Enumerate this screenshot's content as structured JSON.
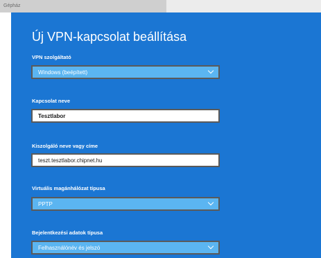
{
  "window": {
    "title": "Gépház"
  },
  "page": {
    "heading": "Új VPN-kapcsolat beállítása"
  },
  "form": {
    "vpn_provider": {
      "label": "VPN szolgáltató",
      "value": "Windows (beépített)",
      "icon": "chevron-down-icon"
    },
    "connection_name": {
      "label": "Kapcsolat neve",
      "value": "Tesztlabor"
    },
    "server": {
      "label": "Kiszolgáló neve vagy címe",
      "value": "teszt.tesztlabor.chipnet.hu"
    },
    "vpn_type": {
      "label": "Virtuális magánhálózat típusa",
      "value": "PPTP",
      "icon": "chevron-down-icon"
    },
    "signin_type": {
      "label": "Bejelentkezési adatok típusa",
      "value": "Felhasználónév és jelszó",
      "icon": "chevron-down-icon"
    }
  },
  "colors": {
    "panel_background": "#1b76d3",
    "select_background": "#5bb5f1",
    "input_background": "#ffffff",
    "control_border": "#5a5a5a",
    "text_on_panel": "#ffffff"
  }
}
